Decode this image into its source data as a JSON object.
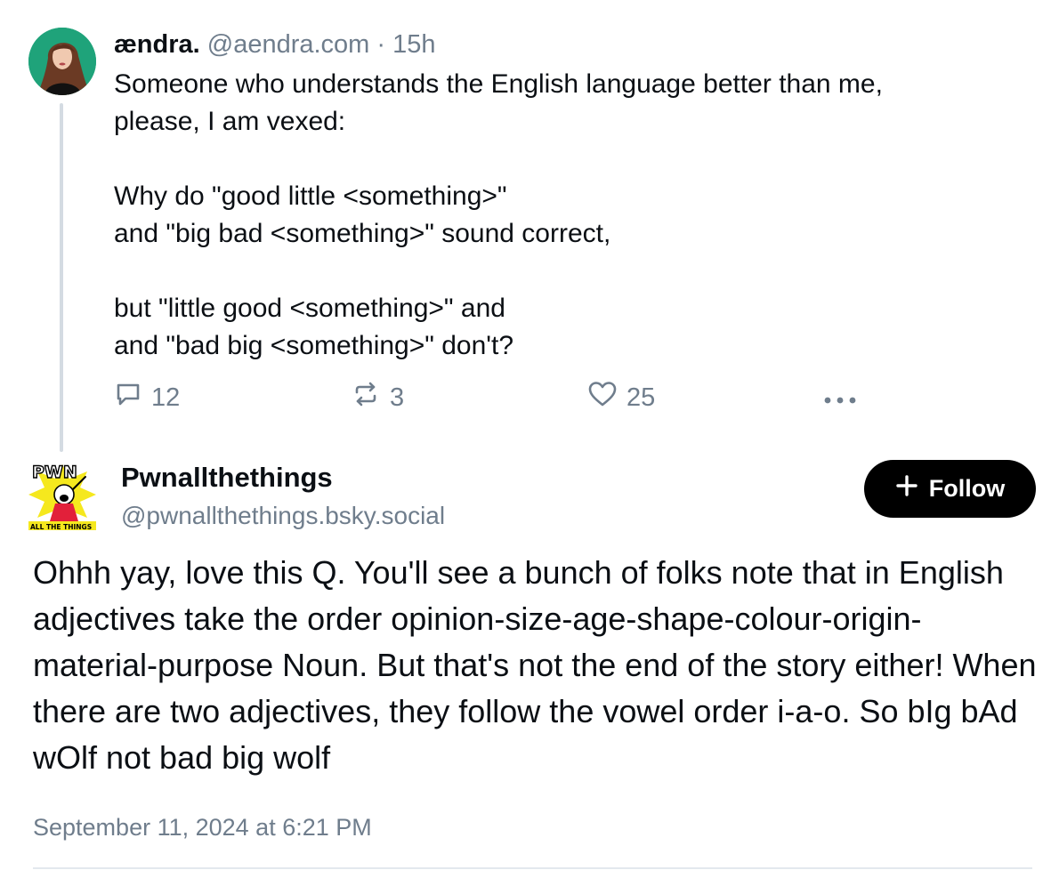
{
  "parent_post": {
    "display_name": "ændra.",
    "handle": "@aendra.com",
    "separator": " · ",
    "time_ago": "15h",
    "body": "Someone who understands the English language better than me,\nplease, I am vexed:\n\nWhy do \"good little <something>\"\nand \"big bad <something>\" sound correct,\n\nbut \"little good <something>\" and\nand \"bad big <something>\" don't?",
    "reply_count": "12",
    "repost_count": "3",
    "like_count": "25",
    "icons": {
      "reply": "reply-bubble-icon",
      "repost": "repost-icon",
      "like": "heart-icon",
      "more": "more-dots-icon"
    }
  },
  "reply_post": {
    "display_name": "Pwnallthethings",
    "handle": "@pwnallthethings.bsky.social",
    "avatar_text_top": "PWN",
    "avatar_text_bottom": "ALL THE THINGS",
    "follow_label": "Follow",
    "body": "Ohhh yay, love this Q. You'll see a bunch of folks note that in English adjectives take the order opinion-size-age-shape-colour-origin-material-purpose Noun. But that's not the end of the story either! When there are two adjectives, they follow the vowel order i-a-o. So bIg bAd wOlf not bad big wolf",
    "timestamp": "September 11, 2024 at 6:21 PM"
  },
  "colors": {
    "text": "#0b0f14",
    "muted": "#6f7d8c",
    "thread_line": "#d4dbe2",
    "follow_bg": "#000000",
    "follow_text": "#ffffff",
    "avatar_bg": "#1fa37a",
    "pwn_yellow": "#f5e81e"
  }
}
